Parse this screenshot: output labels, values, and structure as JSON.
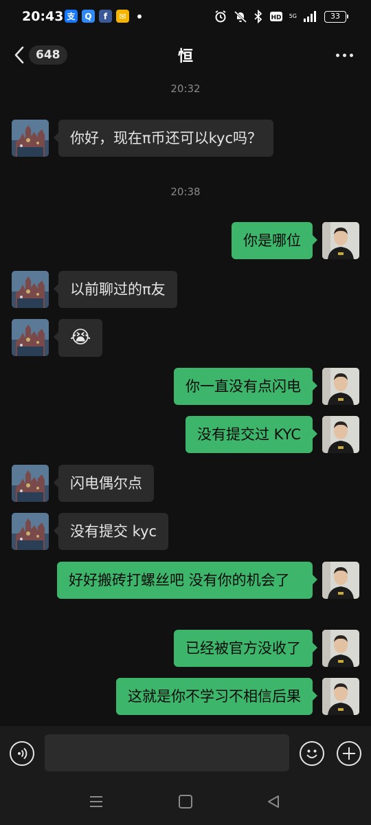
{
  "status_bar": {
    "time": "20:43",
    "apps": [
      {
        "icon": "alipay-icon",
        "glyph": "支",
        "color": "#1677ff"
      },
      {
        "icon": "search-app-icon",
        "glyph": "Q",
        "color": "#2f8af5"
      },
      {
        "icon": "facebook-icon",
        "glyph": "f",
        "color": "#3b5998"
      },
      {
        "icon": "mail-icon",
        "glyph": "✉",
        "color": "#f5b400"
      }
    ],
    "network": "5G",
    "battery": "33"
  },
  "header": {
    "unread_count": "648",
    "title": "恒"
  },
  "messages": [
    {
      "type": "time",
      "text": "20:32"
    },
    {
      "type": "msg",
      "side": "left",
      "text": "你好，现在π币还可以kyc吗？"
    },
    {
      "type": "time",
      "text": "20:38"
    },
    {
      "type": "msg",
      "side": "right",
      "text": "你是哪位"
    },
    {
      "type": "msg",
      "side": "left",
      "text": "以前聊过的π友"
    },
    {
      "type": "msg",
      "side": "left",
      "text": "😭",
      "emoji": true
    },
    {
      "type": "msg",
      "side": "right",
      "text": "你一直没有点闪电"
    },
    {
      "type": "msg",
      "side": "right",
      "text": "没有提交过 KYC"
    },
    {
      "type": "msg",
      "side": "left",
      "text": "闪电偶尔点"
    },
    {
      "type": "msg",
      "side": "left",
      "text": "没有提交 kyc"
    },
    {
      "type": "msg",
      "side": "right",
      "text": "好好搬砖打螺丝吧 没有你的机会了"
    },
    {
      "type": "msg",
      "side": "right",
      "text": "已经被官方没收了"
    },
    {
      "type": "msg",
      "side": "right",
      "text": "这就是你不学习不相信后果"
    }
  ],
  "input": {
    "value": "",
    "placeholder": ""
  },
  "colors": {
    "background": "#111111",
    "bubble_left": "#2b2b2b",
    "bubble_right": "#3db66b",
    "bar": "#1b1b1b"
  }
}
